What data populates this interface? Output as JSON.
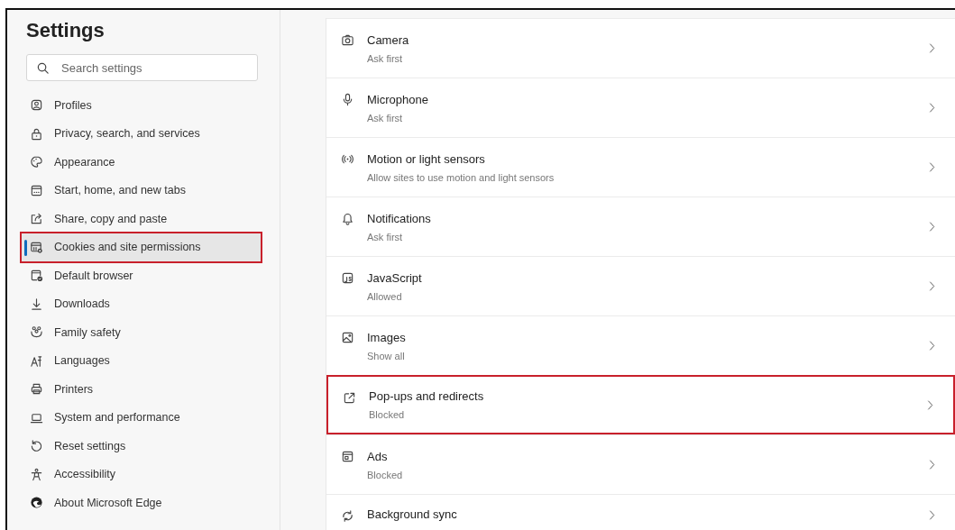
{
  "sidebar": {
    "title": "Settings",
    "search": {
      "placeholder": "Search settings"
    },
    "items": [
      {
        "label": "Profiles",
        "selected": false,
        "highlighted": false
      },
      {
        "label": "Privacy, search, and services",
        "selected": false,
        "highlighted": false
      },
      {
        "label": "Appearance",
        "selected": false,
        "highlighted": false
      },
      {
        "label": "Start, home, and new tabs",
        "selected": false,
        "highlighted": false
      },
      {
        "label": "Share, copy and paste",
        "selected": false,
        "highlighted": false
      },
      {
        "label": "Cookies and site permissions",
        "selected": true,
        "highlighted": true
      },
      {
        "label": "Default browser",
        "selected": false,
        "highlighted": false
      },
      {
        "label": "Downloads",
        "selected": false,
        "highlighted": false
      },
      {
        "label": "Family safety",
        "selected": false,
        "highlighted": false
      },
      {
        "label": "Languages",
        "selected": false,
        "highlighted": false
      },
      {
        "label": "Printers",
        "selected": false,
        "highlighted": false
      },
      {
        "label": "System and performance",
        "selected": false,
        "highlighted": false
      },
      {
        "label": "Reset settings",
        "selected": false,
        "highlighted": false
      },
      {
        "label": "Accessibility",
        "selected": false,
        "highlighted": false
      },
      {
        "label": "About Microsoft Edge",
        "selected": false,
        "highlighted": false
      }
    ]
  },
  "permissions": [
    {
      "title": "Camera",
      "subtitle": "Ask first",
      "highlighted": false
    },
    {
      "title": "Microphone",
      "subtitle": "Ask first",
      "highlighted": false
    },
    {
      "title": "Motion or light sensors",
      "subtitle": "Allow sites to use motion and light sensors",
      "highlighted": false
    },
    {
      "title": "Notifications",
      "subtitle": "Ask first",
      "highlighted": false
    },
    {
      "title": "JavaScript",
      "subtitle": "Allowed",
      "highlighted": false
    },
    {
      "title": "Images",
      "subtitle": "Show all",
      "highlighted": false
    },
    {
      "title": "Pop-ups and redirects",
      "subtitle": "Blocked",
      "highlighted": true
    },
    {
      "title": "Ads",
      "subtitle": "Blocked",
      "highlighted": false
    },
    {
      "title": "Background sync",
      "highlighted": false
    }
  ]
}
